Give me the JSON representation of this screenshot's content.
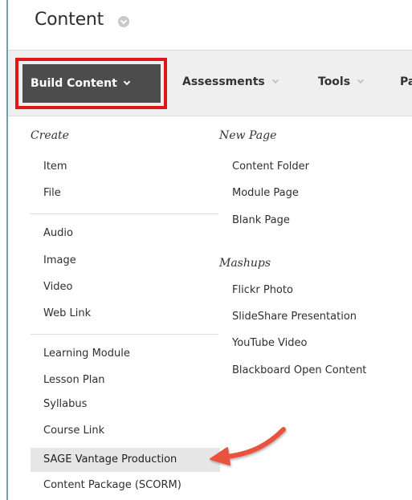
{
  "header": {
    "title": "Content",
    "title_icon": "chevron-down-circle-icon"
  },
  "toolbar": {
    "items": [
      {
        "label": "Build Content",
        "icon": "chevron-down-icon",
        "active": true
      },
      {
        "label": "Assessments",
        "icon": "chevron-down-icon"
      },
      {
        "label": "Tools",
        "icon": "chevron-down-icon"
      },
      {
        "label": "Pa"
      }
    ]
  },
  "menu": {
    "create_heading": "Create",
    "create_items": [
      "Item",
      "File",
      "Audio",
      "Image",
      "Video",
      "Web Link",
      "Learning Module",
      "Lesson Plan",
      "Syllabus",
      "Course Link",
      "SAGE Vantage Production",
      "Content Package (SCORM)"
    ],
    "new_page_heading": "New Page",
    "new_page_items": [
      "Content Folder",
      "Module Page",
      "Blank Page"
    ],
    "mashups_heading": "Mashups",
    "mashups_items": [
      "Flickr Photo",
      "SlideShare Presentation",
      "YouTube Video",
      "Blackboard Open Content"
    ],
    "selected_item": "SAGE Vantage Production"
  },
  "colors": {
    "highlight_border": "#e0161d",
    "active_button_bg": "#4c4c4c",
    "toolbar_bg": "#efefef",
    "arrow": "#e8533f"
  }
}
